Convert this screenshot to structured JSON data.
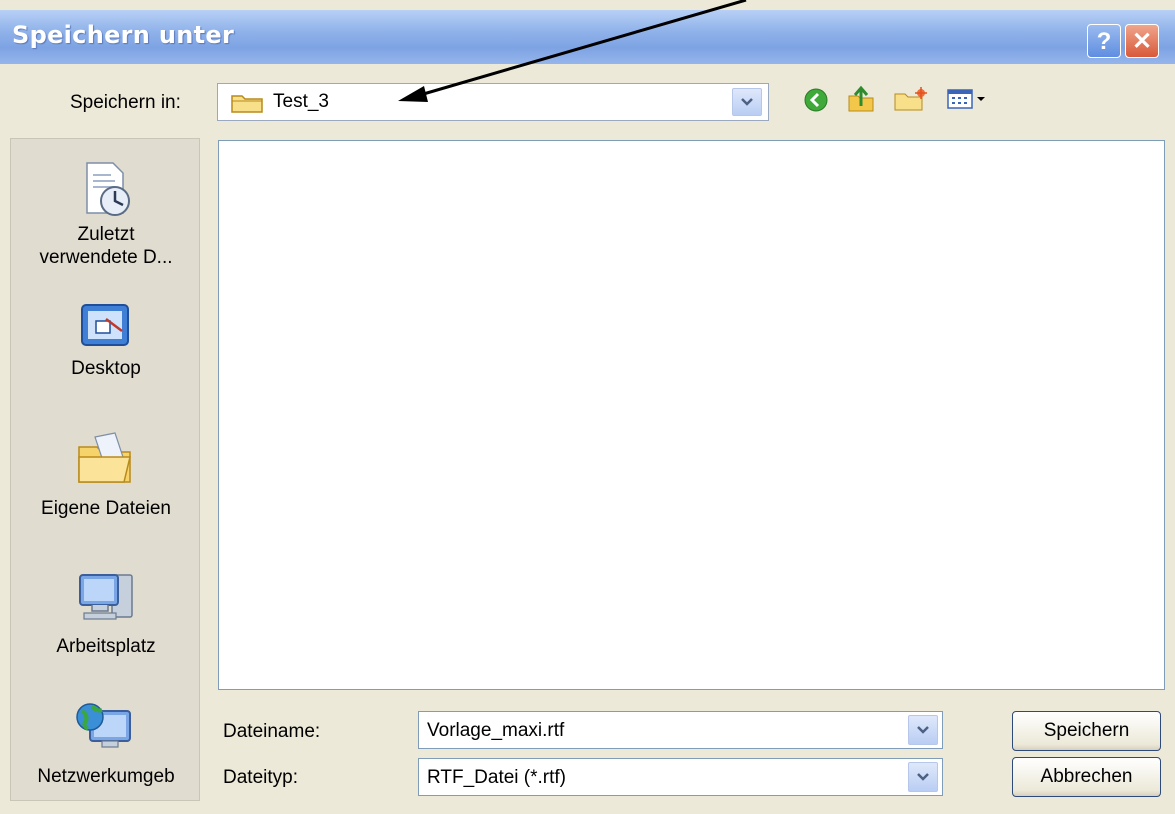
{
  "window": {
    "title": "Speichern unter",
    "help_label": "?",
    "close_label": "✕"
  },
  "toolbar": {
    "lookin_label": "Speichern in:",
    "lookin_value": "Test_3",
    "back_icon": "back-icon",
    "up_icon": "up-folder-icon",
    "new_folder_icon": "new-folder-icon",
    "views_icon": "views-menu-icon"
  },
  "places": [
    {
      "label_line1": "Zuletzt",
      "label_line2": "verwendete D...",
      "icon": "recent-documents-icon"
    },
    {
      "label_line1": "Desktop",
      "label_line2": "",
      "icon": "desktop-icon"
    },
    {
      "label_line1": "Eigene Dateien",
      "label_line2": "",
      "icon": "my-documents-icon"
    },
    {
      "label_line1": "Arbeitsplatz",
      "label_line2": "",
      "icon": "my-computer-icon"
    },
    {
      "label_line1": "Netzwerkumgeb",
      "label_line2": "",
      "icon": "network-icon"
    }
  ],
  "filename": {
    "label": "Dateiname:",
    "value": "Vorlage_maxi.rtf"
  },
  "filetype": {
    "label": "Dateityp:",
    "value": "RTF_Datei (*.rtf)"
  },
  "buttons": {
    "save": "Speichern",
    "cancel": "Abbrechen"
  }
}
